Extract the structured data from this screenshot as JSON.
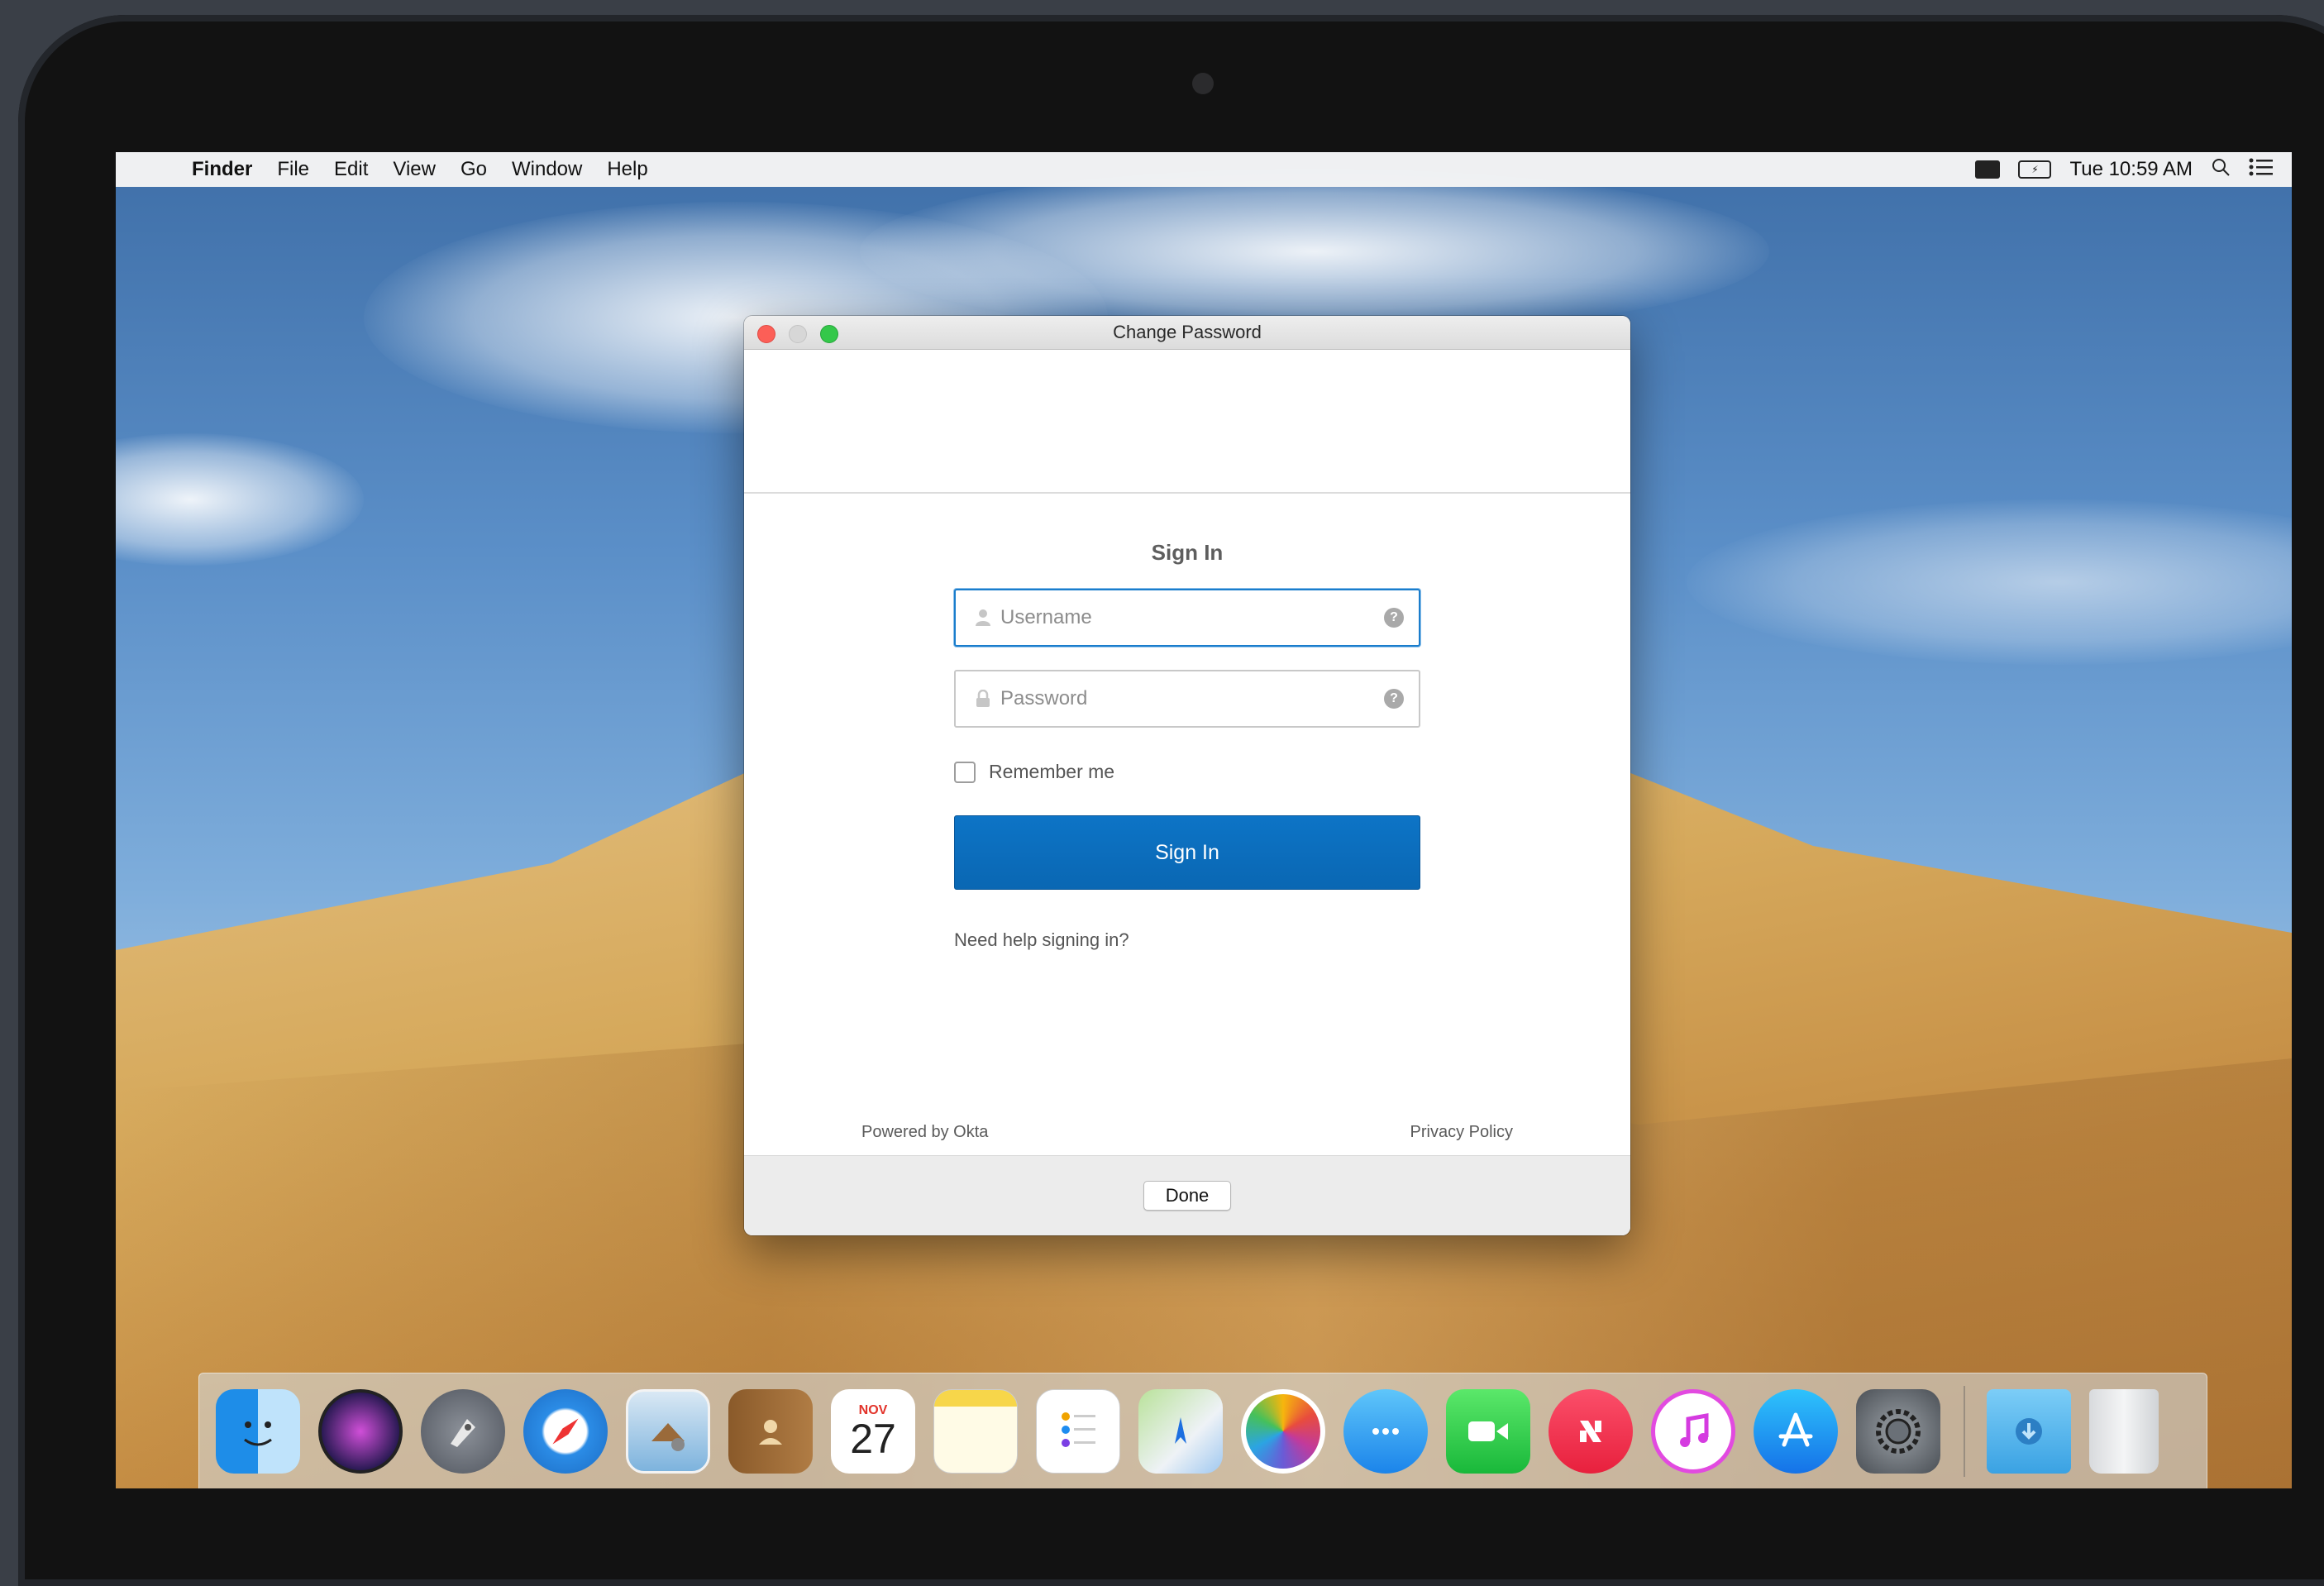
{
  "menubar": {
    "apple": "",
    "items": [
      "Finder",
      "File",
      "Edit",
      "View",
      "Go",
      "Window",
      "Help"
    ],
    "clock": "Tue 10:59 AM",
    "battery_label": "⚡"
  },
  "window": {
    "title": "Change Password",
    "signin_title": "Sign In",
    "username_placeholder": "Username",
    "password_placeholder": "Password",
    "help_glyph": "?",
    "remember_label": "Remember me",
    "signin_button": "Sign In",
    "help_link": "Need help signing in?",
    "powered_by": "Powered by Okta",
    "privacy": "Privacy Policy",
    "done_button": "Done"
  },
  "dock": {
    "calendar_month": "NOV",
    "calendar_day": "27",
    "icons": [
      "finder-icon",
      "siri-icon",
      "launchpad-icon",
      "safari-icon",
      "mail-icon",
      "contacts-icon",
      "calendar-icon",
      "notes-icon",
      "reminders-icon",
      "maps-icon",
      "photos-icon",
      "messages-icon",
      "facetime-icon",
      "news-icon",
      "itunes-icon",
      "app-store-icon",
      "system-preferences-icon",
      "downloads-folder-icon",
      "trash-icon"
    ]
  },
  "colors": {
    "accent": "#0a6bb8",
    "focus_border": "#1a7dcc"
  }
}
